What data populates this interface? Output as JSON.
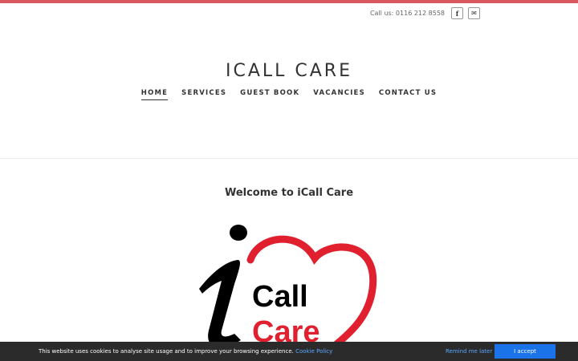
{
  "header": {
    "phone": "Call us: 0116 212 8558",
    "social": [
      {
        "icon": "facebook-icon",
        "glyph": "f"
      },
      {
        "icon": "email-icon",
        "glyph": "✉"
      }
    ],
    "accent_color": "#d9575f"
  },
  "site": {
    "title": "ICALL CARE"
  },
  "nav": {
    "items": [
      {
        "label": "HOME",
        "active": true
      },
      {
        "label": "SERVICES",
        "active": false
      },
      {
        "label": "GUEST BOOK",
        "active": false
      },
      {
        "label": "VACANCIES",
        "active": false
      },
      {
        "label": "CONTACT US",
        "active": false
      }
    ]
  },
  "main": {
    "heading": "Welcome to iCall Care",
    "logo": {
      "word1": "Call",
      "word2": "Care",
      "heart_color": "#e0202f",
      "text_color": "#000000"
    }
  },
  "cookie": {
    "message": "This website uses cookies to analyse site usage and to improve your browsing experience.",
    "link_label": "Cookie Policy",
    "remind_label": "Remind me later",
    "accept_label": "I accept"
  }
}
